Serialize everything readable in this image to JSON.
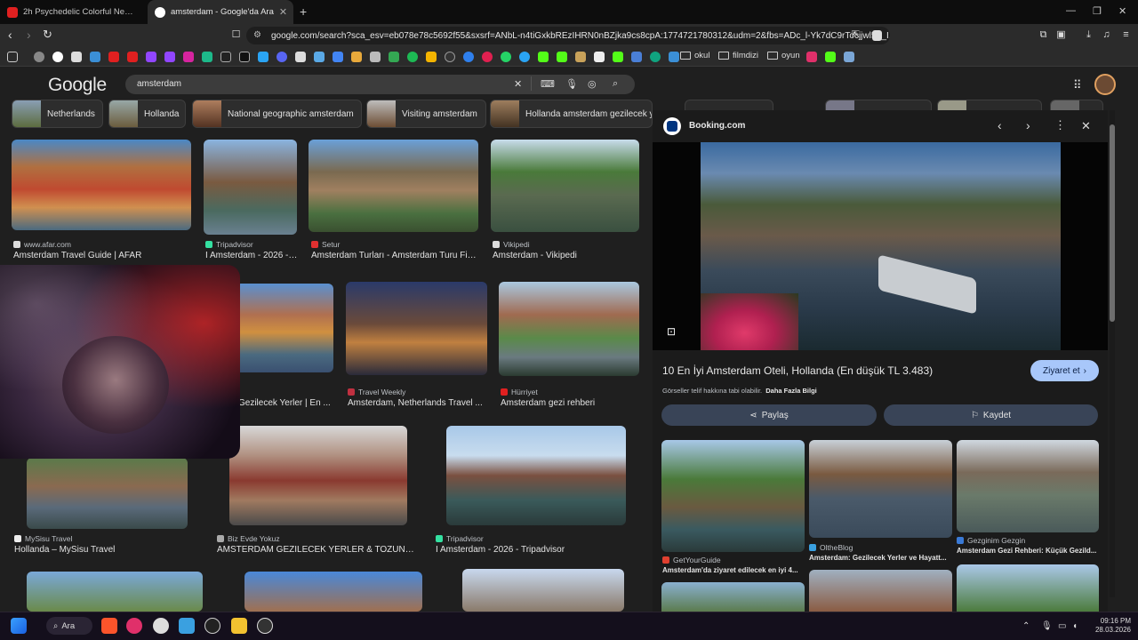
{
  "browser": {
    "tabs": [
      {
        "label": "2h Psychedelic Colorful Neon Backgr",
        "favicon": "youtube-icon",
        "active": false
      },
      {
        "label": "amsterdam - Google'da Ara",
        "favicon": "google-icon",
        "active": true
      }
    ],
    "new_tab": "+",
    "address": "google.com/search?sca_esv=eb078e78c5692f55&sxsrf=ANbL-n4tiGxkbREzIHRN0nBZjka9cs8cpA:1774721780312&udm=2&fbs=ADc_l-Yk7dC9rTocjjwl5T_I...",
    "bookmark_folders": [
      "okul",
      "filmdizi",
      "oyun"
    ]
  },
  "google": {
    "logo": "Google",
    "query": "amsterdam",
    "chips": [
      "Netherlands",
      "Hollanda",
      "National geographic amsterdam",
      "Visiting amsterdam",
      "Hollanda amsterdam gezilecek yerler"
    ]
  },
  "results": [
    {
      "source": "www.afar.com",
      "title": "Amsterdam Travel Guide | AFAR"
    },
    {
      "source": "Tripadvisor",
      "title": "I Amsterdam - 2026 - ..."
    },
    {
      "source": "Setur",
      "title": "Amsterdam Turları - Amsterdam Turu Fiy..."
    },
    {
      "source": "Vikipedi",
      "title": "Amsterdam - Vikipedi"
    },
    {
      "source": "",
      "title": "Gezilecek Yerler | En ..."
    },
    {
      "source": "Travel Weekly",
      "title": "Amsterdam, Netherlands Travel ..."
    },
    {
      "source": "Hürriyet",
      "title": "Amsterdam gezi rehberi"
    },
    {
      "source": "MySisu Travel",
      "title": "Hollanda – MySisu Travel"
    },
    {
      "source": "Biz Evde Yokuz",
      "title": "AMSTERDAM GEZİLECEK YERLER & TOZUNU A..."
    },
    {
      "source": "Tripadvisor",
      "title": "I Amsterdam - 2026 - Tripadvisor"
    }
  ],
  "panel": {
    "source": "Booking.com",
    "title": "10 En İyi Amsterdam Oteli, Hollanda (En düşük TL 3.483)",
    "visit_button": "Ziyaret et",
    "copyright": "Görseller telif hakkına tabi olabilir.",
    "more_info": "Daha Fazla Bilgi",
    "share": "Paylaş",
    "save": "Kaydet",
    "related": [
      {
        "source": "GetYourGuide",
        "title": "Amsterdam'da ziyaret edilecek en iyi 4..."
      },
      {
        "source": "OltheBlog",
        "title": "Amsterdam: Gezilecek Yerler ve Hayatt..."
      },
      {
        "source": "Gezginim Gezgin",
        "title": "Amsterdam Gezi Rehberi: Küçük Gezild..."
      }
    ]
  },
  "taskbar": {
    "search_label": "Ara",
    "time": "09:16 PM",
    "date": "28.03.2026"
  }
}
